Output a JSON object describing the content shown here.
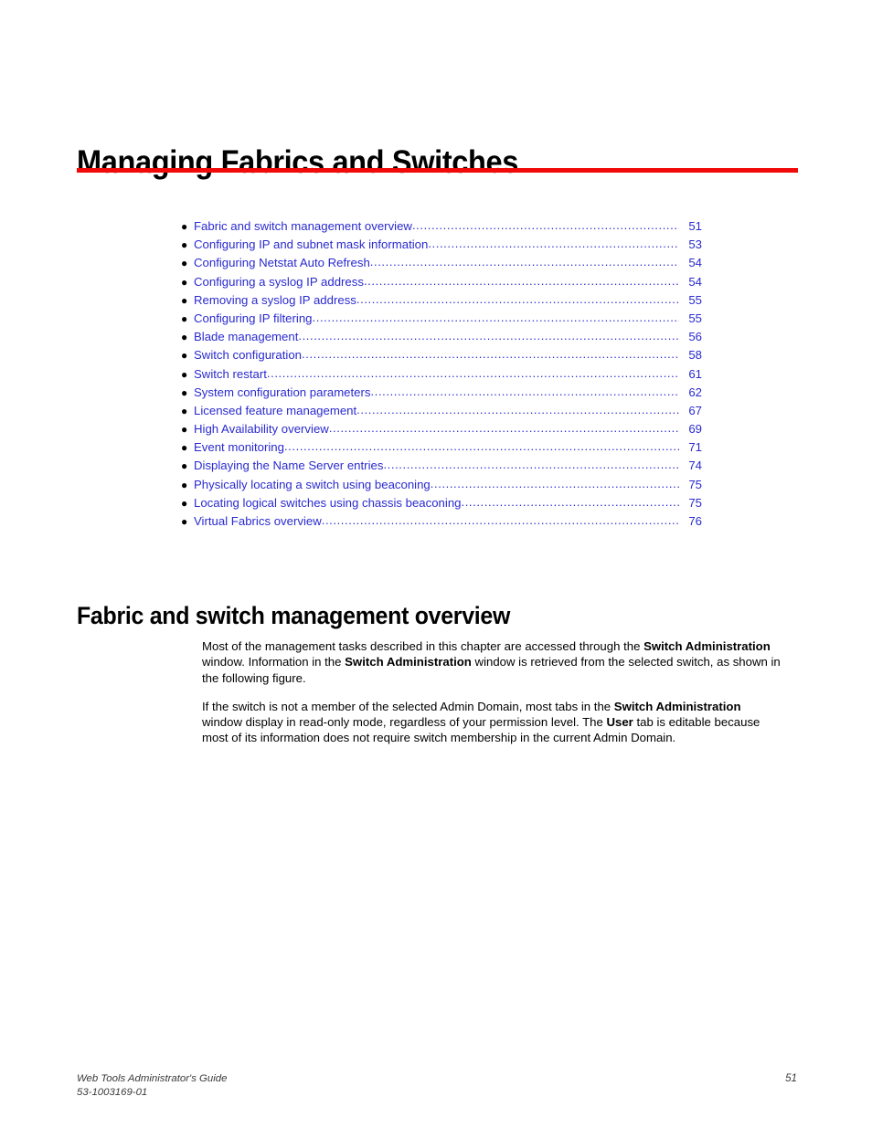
{
  "chapter": {
    "title": "Managing Fabrics and Switches",
    "rule_color": "#f00a0a"
  },
  "toc": {
    "bullet_glyph": "●",
    "link_color": "#2a2ad0",
    "items": [
      {
        "label": "Fabric and switch management overview",
        "page": "51"
      },
      {
        "label": "Configuring IP and subnet mask information",
        "page": "53"
      },
      {
        "label": "Configuring Netstat Auto Refresh",
        "page": "54"
      },
      {
        "label": "Configuring a syslog IP address",
        "page": "54"
      },
      {
        "label": "Removing a syslog IP address",
        "page": "55"
      },
      {
        "label": "Configuring IP filtering",
        "page": "55"
      },
      {
        "label": "Blade management",
        "page": "56"
      },
      {
        "label": "Switch configuration",
        "page": "58"
      },
      {
        "label": "Switch restart",
        "page": "61"
      },
      {
        "label": "System configuration parameters",
        "page": "62"
      },
      {
        "label": "Licensed feature management",
        "page": "67"
      },
      {
        "label": "High Availability overview",
        "page": "69"
      },
      {
        "label": "Event monitoring",
        "page": "71"
      },
      {
        "label": "Displaying the Name Server entries",
        "page": "74"
      },
      {
        "label": "Physically locating a switch using beaconing",
        "page": "75"
      },
      {
        "label": "Locating logical switches using chassis beaconing",
        "page": "75"
      },
      {
        "label": "Virtual Fabrics overview",
        "page": "76"
      }
    ]
  },
  "section": {
    "heading": "Fabric and switch management overview",
    "paragraph1": {
      "part1": "Most of the management tasks described in this chapter are accessed through the ",
      "bold1": "Switch Administration",
      "part2": " window. Information in the ",
      "bold2": "Switch Administration",
      "part3": " window is retrieved from the selected switch, as shown in the following figure."
    },
    "paragraph2": {
      "part1": "If the switch is not a member of the selected Admin Domain, most tabs in the ",
      "bold1": "Switch Administration",
      "part2": " window display in read-only mode, regardless of your permission level. The ",
      "bold2": "User",
      "part3": " tab is editable because most of its information does not require switch membership in the current Admin Domain."
    }
  },
  "footer": {
    "guide_title": "Web Tools Administrator's Guide",
    "document_number": "53-1003169-01",
    "page_number": "51"
  }
}
